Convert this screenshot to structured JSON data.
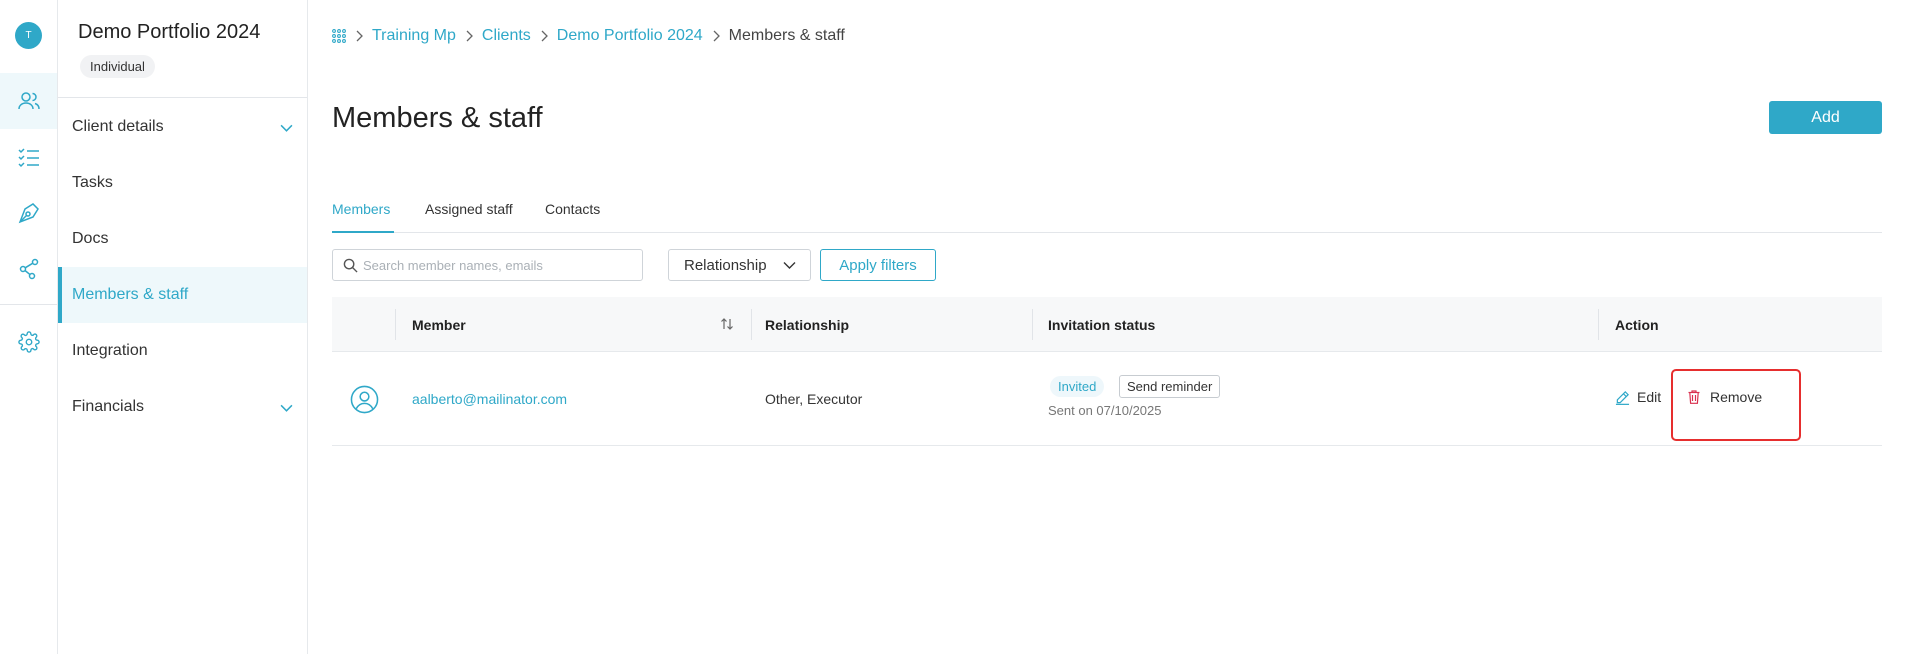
{
  "user": {
    "avatar_initial": "T"
  },
  "rail": {
    "items": [
      {
        "icon": "people-icon",
        "active": true
      },
      {
        "icon": "checklist-icon",
        "active": false
      },
      {
        "icon": "pen-nib-icon",
        "active": false
      },
      {
        "icon": "share-network-icon",
        "active": false
      },
      {
        "icon": "gear-icon",
        "active": false
      }
    ]
  },
  "sidebar": {
    "title": "Demo Portfolio 2024",
    "badge": "Individual",
    "items": [
      {
        "label": "Client details",
        "expandable": true
      },
      {
        "label": "Tasks"
      },
      {
        "label": "Docs"
      },
      {
        "label": "Members & staff",
        "active": true
      },
      {
        "label": "Integration"
      },
      {
        "label": "Financials",
        "expandable": true
      }
    ]
  },
  "breadcrumb": {
    "icon": "apps-grid-icon",
    "items": [
      "Training Mp",
      "Clients",
      "Demo Portfolio 2024"
    ],
    "current": "Members & staff"
  },
  "page": {
    "title": "Members & staff",
    "add_label": "Add"
  },
  "tabs": [
    {
      "label": "Members",
      "active": true
    },
    {
      "label": "Assigned staff"
    },
    {
      "label": "Contacts"
    }
  ],
  "filters": {
    "search_placeholder": "Search member names, emails",
    "relationship_label": "Relationship",
    "apply_label": "Apply filters"
  },
  "table": {
    "columns": [
      "Member",
      "Relationship",
      "Invitation status",
      "Action"
    ],
    "rows": [
      {
        "email": "aalberto@mailinator.com",
        "relationship": "Other, Executor",
        "status": "Invited",
        "reminder_label": "Send reminder",
        "sent": "Sent on 07/10/2025",
        "edit_label": "Edit",
        "remove_label": "Remove"
      }
    ]
  },
  "colors": {
    "accent": "#2fa8c8",
    "highlight": "#e62e2e",
    "danger_icon": "#d9304f"
  }
}
